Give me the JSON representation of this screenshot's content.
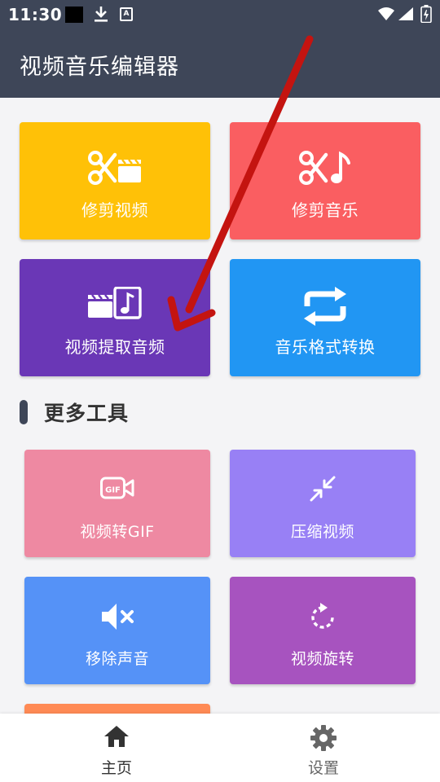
{
  "status": {
    "time": "11:30",
    "badge": "A"
  },
  "app": {
    "title": "视频音乐编辑器"
  },
  "main_tools": [
    {
      "label": "修剪视频",
      "icon": "scissors-film-icon",
      "color": "#FFC107"
    },
    {
      "label": "修剪音乐",
      "icon": "scissors-note-icon",
      "color": "#FA5E61"
    },
    {
      "label": "视频提取音频",
      "icon": "film-music-icon",
      "color": "#6A37B6"
    },
    {
      "label": "音乐格式转换",
      "icon": "repeat-icon",
      "color": "#2196F3"
    }
  ],
  "more_tools": {
    "heading": "更多工具",
    "items": [
      {
        "label": "视频转GIF",
        "icon": "gif-camera-icon",
        "color": "#EE89A2"
      },
      {
        "label": "压缩视频",
        "icon": "compress-arrows-icon",
        "color": "#9880F5"
      },
      {
        "label": "移除声音",
        "icon": "volume-mute-icon",
        "color": "#5592F7"
      },
      {
        "label": "视频旋转",
        "icon": "rotate-icon",
        "color": "#A753BF"
      }
    ]
  },
  "nav": [
    {
      "label": "主页",
      "icon": "home-icon",
      "active": true
    },
    {
      "label": "设置",
      "icon": "gear-icon",
      "active": false
    }
  ],
  "colors": {
    "primary": "#3E4658",
    "arrow": "#C41410",
    "nav_active": "#333333",
    "nav_inactive": "#666666"
  }
}
